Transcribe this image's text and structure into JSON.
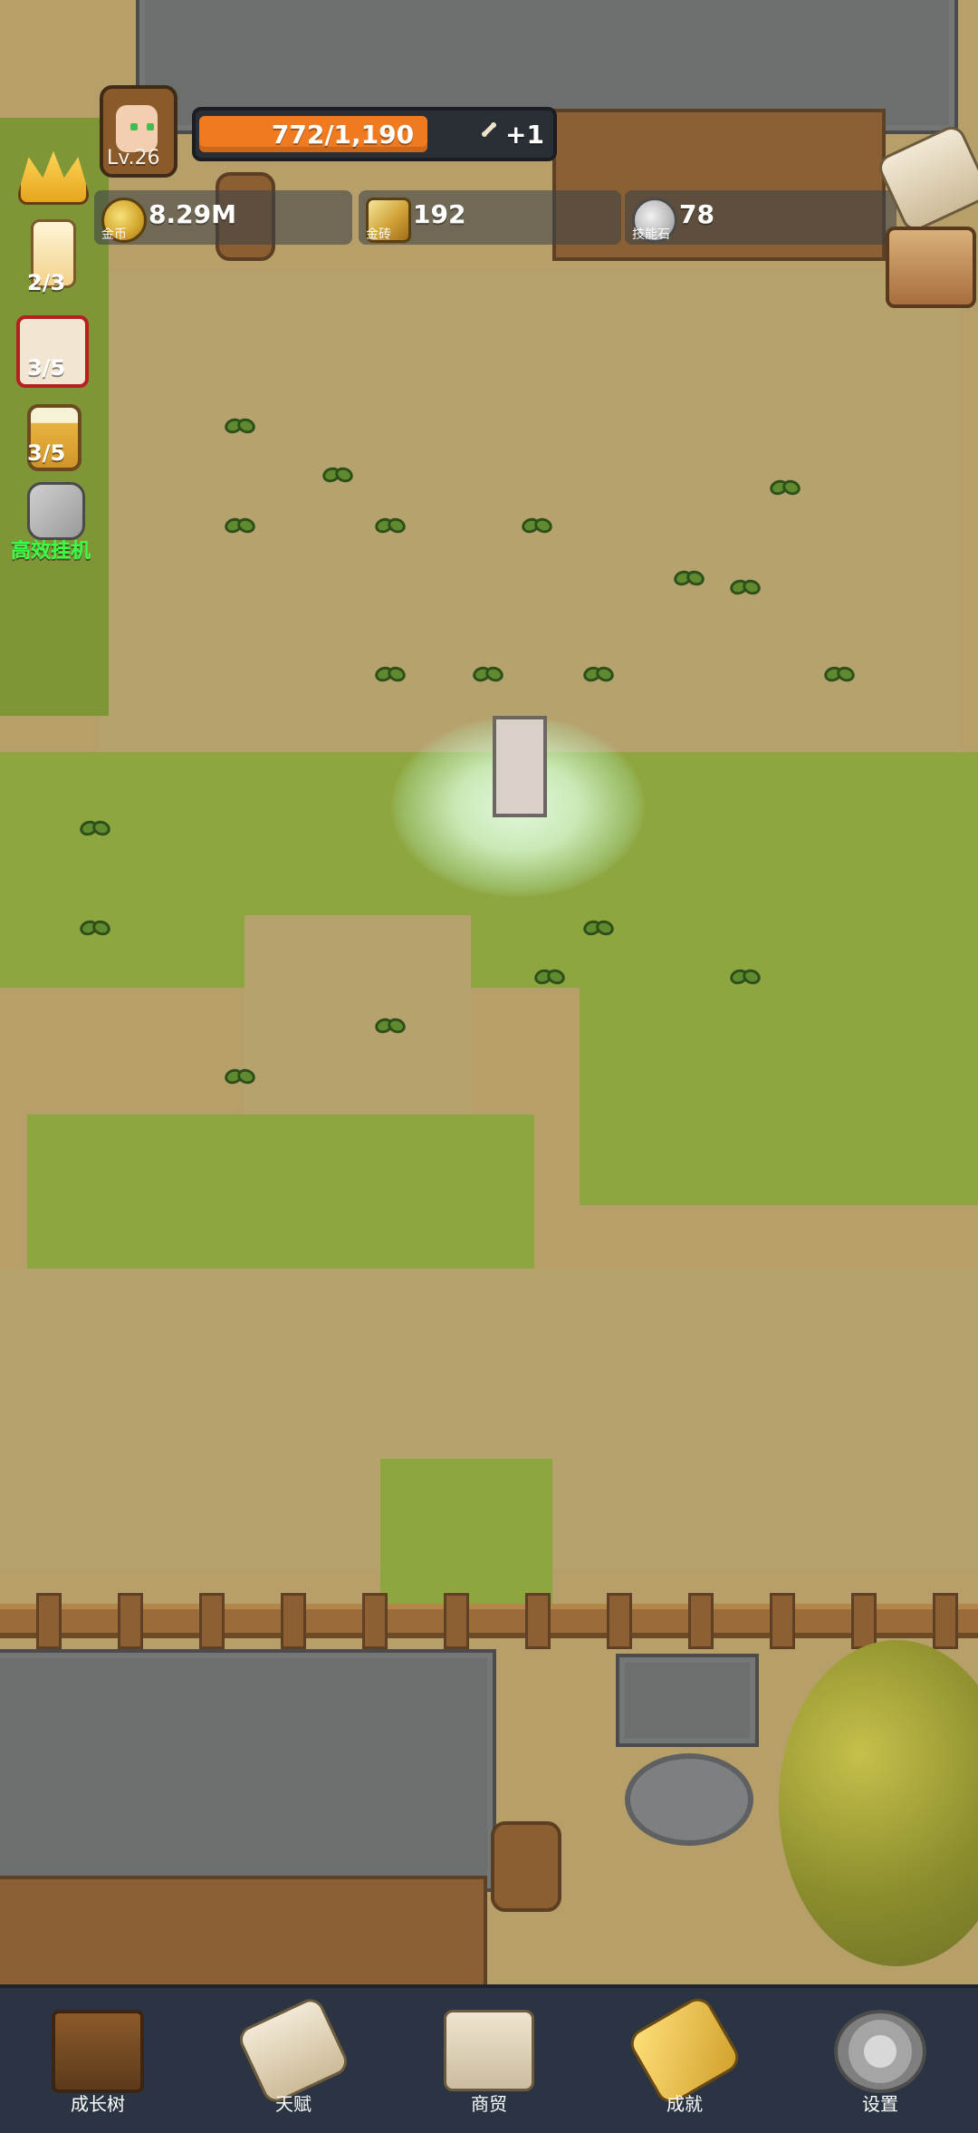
{
  "hud": {
    "level": "Lv.26",
    "xp_text": "772/1,190",
    "xp_fraction": 0.65,
    "xp_bonus": "+1"
  },
  "resources": [
    {
      "icon": "gold-coin-icon",
      "value": "8.29M",
      "label": "金币"
    },
    {
      "icon": "gold-bar-icon",
      "value": "192",
      "label": "金砖"
    },
    {
      "icon": "skill-stone-icon",
      "value": "78",
      "label": "技能石"
    }
  ],
  "left_sidebar": [
    {
      "icon": "crown-icon"
    },
    {
      "icon": "candle-icon",
      "count": "2/3"
    },
    {
      "icon": "dice-icon",
      "count": "3/5"
    },
    {
      "icon": "beer-mug-icon",
      "count": "3/5"
    },
    {
      "icon": "wrench-key-icon",
      "label": "高效挂机"
    }
  ],
  "right_sidebar": [
    {
      "icon": "scroll-icon"
    },
    {
      "icon": "treasure-chest-icon"
    }
  ],
  "bottom_nav": [
    {
      "icon": "growth-tree-book-icon",
      "label": "成长树"
    },
    {
      "icon": "talent-scroll-icon",
      "label": "天赋"
    },
    {
      "icon": "trade-map-icon",
      "label": "商贸"
    },
    {
      "icon": "achievement-key-icon",
      "label": "成就"
    },
    {
      "icon": "settings-gear-icon",
      "label": "设置"
    }
  ]
}
